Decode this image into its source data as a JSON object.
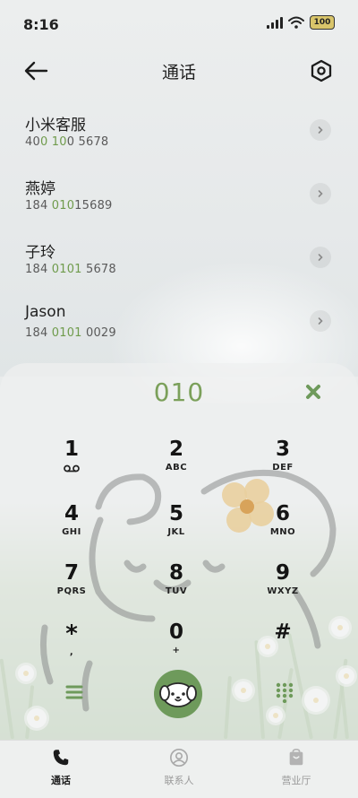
{
  "status_bar": {
    "time": "8:16",
    "battery": "100"
  },
  "header": {
    "title": "通话"
  },
  "calls": [
    {
      "name": "小米客服",
      "number_pre": "40",
      "number_match": "0 10",
      "number_post": "0 5678"
    },
    {
      "name": "燕婷",
      "number_pre": "184 ",
      "number_match": "010",
      "number_post": "15689"
    },
    {
      "name": "子玲",
      "number_pre": "184 ",
      "number_match": "0101",
      "number_post": " 5678"
    },
    {
      "name": "Jason",
      "number_pre": "184 ",
      "number_match": "0101",
      "number_post": " 0029"
    }
  ],
  "dialer": {
    "input": "010",
    "keys": [
      {
        "digit": "1",
        "letters": ""
      },
      {
        "digit": "2",
        "letters": "ABC"
      },
      {
        "digit": "3",
        "letters": "DEF"
      },
      {
        "digit": "4",
        "letters": "GHI"
      },
      {
        "digit": "5",
        "letters": "JKL"
      },
      {
        "digit": "6",
        "letters": "MNO"
      },
      {
        "digit": "7",
        "letters": "PQRS"
      },
      {
        "digit": "8",
        "letters": "TUV"
      },
      {
        "digit": "9",
        "letters": "WXYZ"
      },
      {
        "digit": "*",
        "letters": ","
      },
      {
        "digit": "0",
        "letters": "+"
      },
      {
        "digit": "#",
        "letters": ""
      }
    ]
  },
  "bottom_nav": {
    "tabs": [
      {
        "label": "通话",
        "icon": "phone-icon",
        "active": true
      },
      {
        "label": "联系人",
        "icon": "contact-icon",
        "active": false
      },
      {
        "label": "营业厅",
        "icon": "store-icon",
        "active": false
      }
    ]
  },
  "colors": {
    "accent": "#7ba05a",
    "call_button": "#6e9a5b",
    "highlight": "#6f9b4c"
  }
}
